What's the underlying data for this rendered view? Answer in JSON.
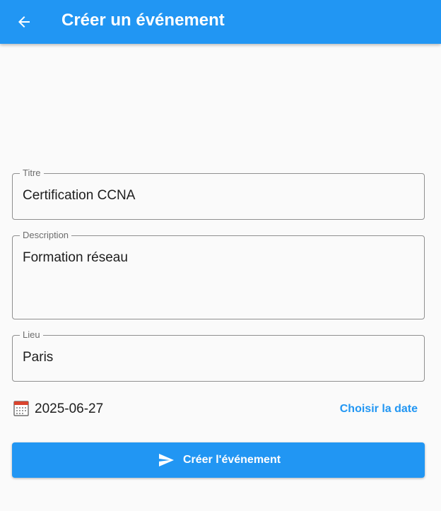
{
  "appbar": {
    "back_icon": "arrow-back-icon",
    "title": "Créer un événement",
    "color": "#2196f3"
  },
  "form": {
    "title_field": {
      "label": "Titre",
      "value": "Certification CCNA"
    },
    "description_field": {
      "label": "Description",
      "value": "Formation réseau"
    },
    "location_field": {
      "label": "Lieu",
      "value": "Paris"
    },
    "date": {
      "icon": "calendar-icon",
      "value": "2025-06-27",
      "choose_label": "Choisir la date"
    },
    "submit": {
      "icon": "send-icon",
      "label": "Créer l'événement"
    }
  }
}
